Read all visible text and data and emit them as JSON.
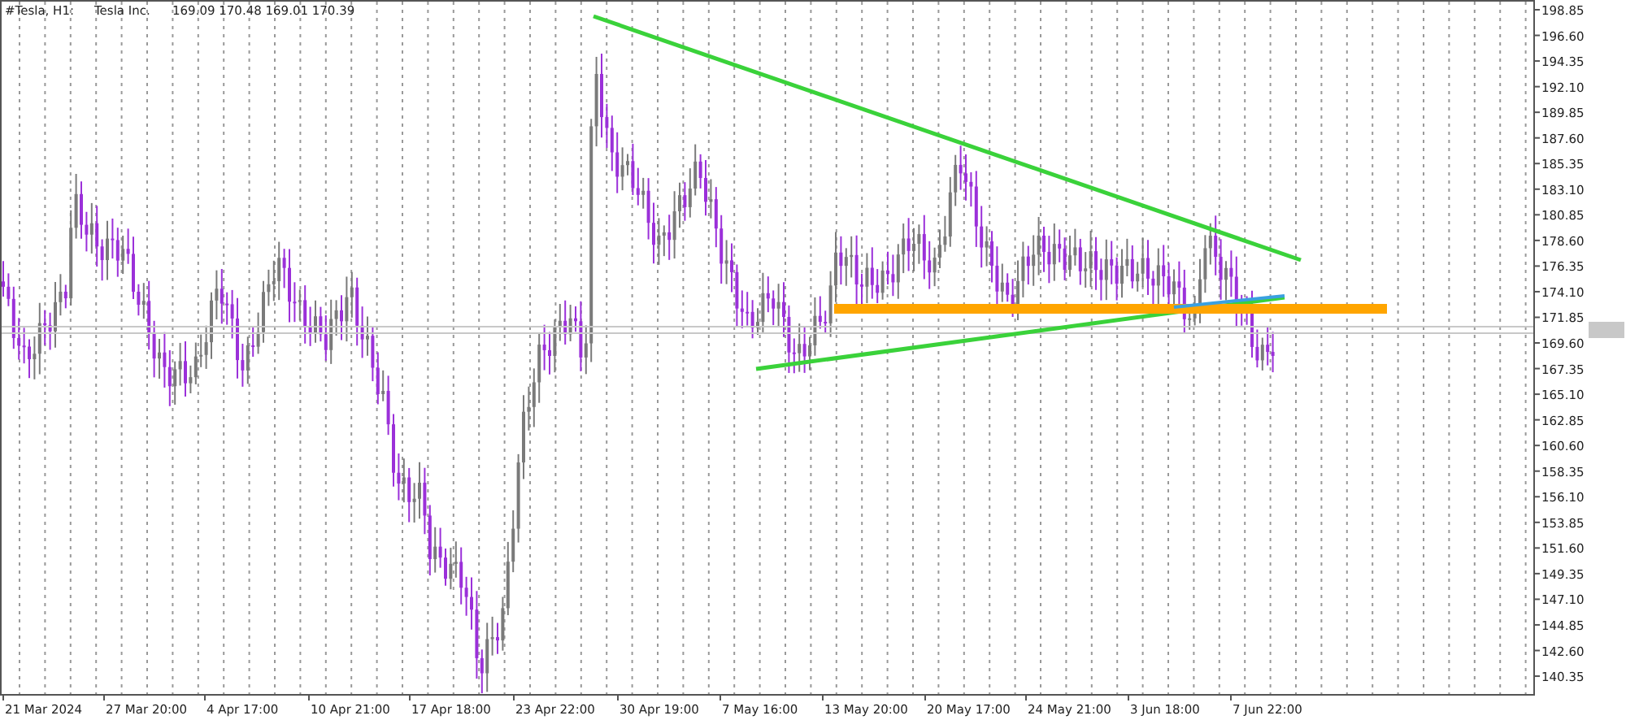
{
  "header": {
    "symbol": "#Tesla, H1:",
    "name": "Tesla Inc.",
    "ohlc": "169.09 170.48 169.01 170.39"
  },
  "price_axis": {
    "labels": [
      "198.85",
      "196.60",
      "194.35",
      "192.10",
      "189.85",
      "187.60",
      "185.35",
      "183.10",
      "180.85",
      "178.60",
      "176.35",
      "174.10",
      "171.85",
      "169.60",
      "167.35",
      "165.10",
      "162.85",
      "160.60",
      "158.35",
      "156.10",
      "153.85",
      "151.60",
      "149.35",
      "147.10",
      "144.85",
      "142.60",
      "140.35"
    ]
  },
  "time_axis": {
    "labels": [
      "21 Mar 2024",
      "27 Mar 20:00",
      "4 Apr 17:00",
      "10 Apr 21:00",
      "17 Apr 18:00",
      "23 Apr 22:00",
      "30 Apr 19:00",
      "7 May 16:00",
      "13 May 20:00",
      "20 May 17:00",
      "24 May 21:00",
      "3 Jun 18:00",
      "7 Jun 22:00"
    ]
  }
}
